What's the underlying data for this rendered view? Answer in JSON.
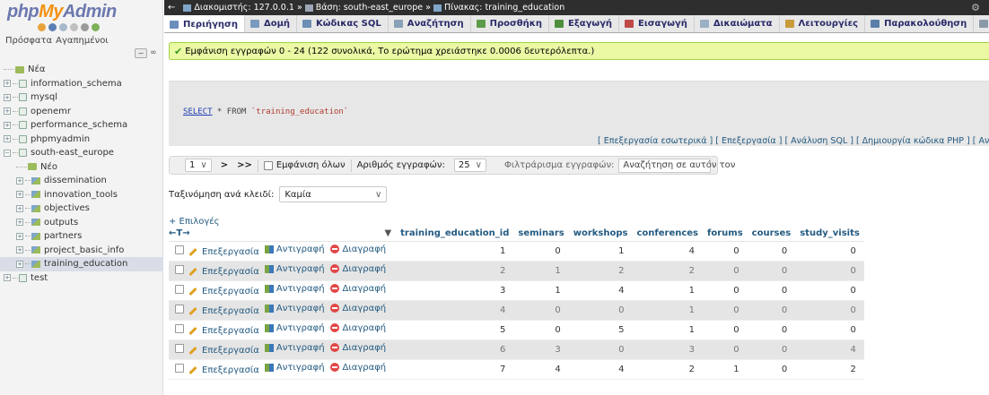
{
  "sidebar": {
    "logo": {
      "php": "php",
      "my": "My",
      "admin": "Admin"
    },
    "recent_label": "Πρόσφατα",
    "favorites_label": "Αγαπημένοι",
    "collapse_label": "−",
    "link_label": "∞",
    "tree": [
      {
        "label": "Νέα",
        "type": "new",
        "indent": 0
      },
      {
        "label": "information_schema",
        "type": "db",
        "indent": 0
      },
      {
        "label": "mysql",
        "type": "db",
        "indent": 0
      },
      {
        "label": "openemr",
        "type": "db",
        "indent": 0
      },
      {
        "label": "performance_schema",
        "type": "db",
        "indent": 0
      },
      {
        "label": "phpmyadmin",
        "type": "db",
        "indent": 0
      },
      {
        "label": "south-east_europe",
        "type": "db-open",
        "indent": 0
      },
      {
        "label": "Νέο",
        "type": "new",
        "indent": 1
      },
      {
        "label": "dissemination",
        "type": "table",
        "indent": 1
      },
      {
        "label": "innovation_tools",
        "type": "table",
        "indent": 1
      },
      {
        "label": "objectives",
        "type": "table",
        "indent": 1
      },
      {
        "label": "outputs",
        "type": "table",
        "indent": 1
      },
      {
        "label": "partners",
        "type": "table",
        "indent": 1
      },
      {
        "label": "project_basic_info",
        "type": "table",
        "indent": 1
      },
      {
        "label": "training_education",
        "type": "table",
        "indent": 1,
        "selected": true
      },
      {
        "label": "test",
        "type": "db",
        "indent": 0
      }
    ]
  },
  "breadcrumb": {
    "server": "Διακομιστής: 127.0.0.1 »",
    "database": "Βάση: south-east_europe »",
    "table": "Πίνακας: training_education"
  },
  "menu": [
    {
      "label": "Περιήγηση",
      "color": "#6c8ebf",
      "active": true
    },
    {
      "label": "Δομή",
      "color": "#7a9abf"
    },
    {
      "label": "Κώδικας SQL",
      "color": "#6b8fb5"
    },
    {
      "label": "Αναζήτηση",
      "color": "#8aa0b8"
    },
    {
      "label": "Προσθήκη",
      "color": "#5c9c4a"
    },
    {
      "label": "Εξαγωγή",
      "color": "#4d8f3c"
    },
    {
      "label": "Εισαγωγή",
      "color": "#c04a4a"
    },
    {
      "label": "Δικαιώματα",
      "color": "#9ab0c4"
    },
    {
      "label": "Λειτουργίες",
      "color": "#c89a3a"
    },
    {
      "label": "Παρακολούθηση",
      "color": "#5a7ea8"
    },
    {
      "label": "Δείκτες",
      "color": "#8a9aaa"
    }
  ],
  "success_message": "Εμφάνιση εγγραφών 0 - 24 (122 συνολικά, Το ερώτημα χρειάστηκε 0.0006 δευτερόλεπτα.)",
  "sql": {
    "keyword": "SELECT",
    "rest": " * FROM ",
    "table": "`training_education`"
  },
  "sql_links": "[ Επεξεργασία εσωτερικά ] [ Επεξεργασία ] [ Ανάλυση SQL ] [ Δημιουργία κώδικα PHP ] [ Ανανέωση",
  "nav": {
    "page": "1",
    "next": ">",
    "last": ">>",
    "show_all": "Εμφάνιση όλων",
    "rows_label": "Αριθμός εγγραφών:",
    "rows_value": "25",
    "filter_label": "Φιλτράρισμα εγγραφών:",
    "filter_placeholder": "Αναζήτηση σε αυτόν τον"
  },
  "sort": {
    "label": "Ταξινόμηση ανά κλειδί:",
    "value": "Καμία"
  },
  "options_label": "+ Επιλογές",
  "arrows_label": "←T→",
  "columns": [
    "training_education_id",
    "seminars",
    "workshops",
    "conferences",
    "forums",
    "courses",
    "study_visits"
  ],
  "actions": {
    "edit": "Επεξεργασία",
    "copy": "Αντιγραφή",
    "delete": "Διαγραφή"
  },
  "rows": [
    [
      1,
      0,
      1,
      4,
      0,
      0,
      0
    ],
    [
      2,
      1,
      2,
      2,
      0,
      0,
      0
    ],
    [
      3,
      1,
      4,
      1,
      0,
      0,
      0
    ],
    [
      4,
      0,
      0,
      1,
      0,
      0,
      0
    ],
    [
      5,
      0,
      5,
      1,
      0,
      0,
      0
    ],
    [
      6,
      3,
      0,
      3,
      0,
      0,
      4
    ],
    [
      7,
      4,
      4,
      2,
      1,
      0,
      2
    ]
  ]
}
